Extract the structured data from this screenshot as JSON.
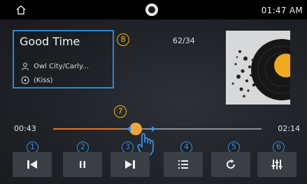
{
  "status_bar": {
    "home_icon": "home-icon",
    "brand_icon": "brand-logo-icon",
    "time": "01:47 AM"
  },
  "track": {
    "title": "Good Time",
    "artist": "Owl City/Carly...",
    "album": "(Kiss)",
    "count": "62/34"
  },
  "progress": {
    "elapsed": "00:43",
    "total": "02:14",
    "fraction": 0.32
  },
  "callouts": {
    "info_box": "8",
    "progress": "7",
    "buttons": [
      "1",
      "2",
      "3",
      "4",
      "5",
      "6"
    ]
  },
  "controls": [
    {
      "name": "previous",
      "icon": "skip-previous-icon"
    },
    {
      "name": "pause",
      "icon": "pause-icon"
    },
    {
      "name": "next",
      "icon": "skip-next-icon"
    },
    {
      "name": "playlist",
      "icon": "list-icon"
    },
    {
      "name": "repeat",
      "icon": "repeat-icon"
    },
    {
      "name": "equalizer",
      "icon": "equalizer-icon"
    }
  ],
  "colors": {
    "accent_orange": "#e0742a",
    "callout_yellow": "#f5b400",
    "callout_blue": "#3a8fe0",
    "highlight_border": "#2f86d6"
  }
}
